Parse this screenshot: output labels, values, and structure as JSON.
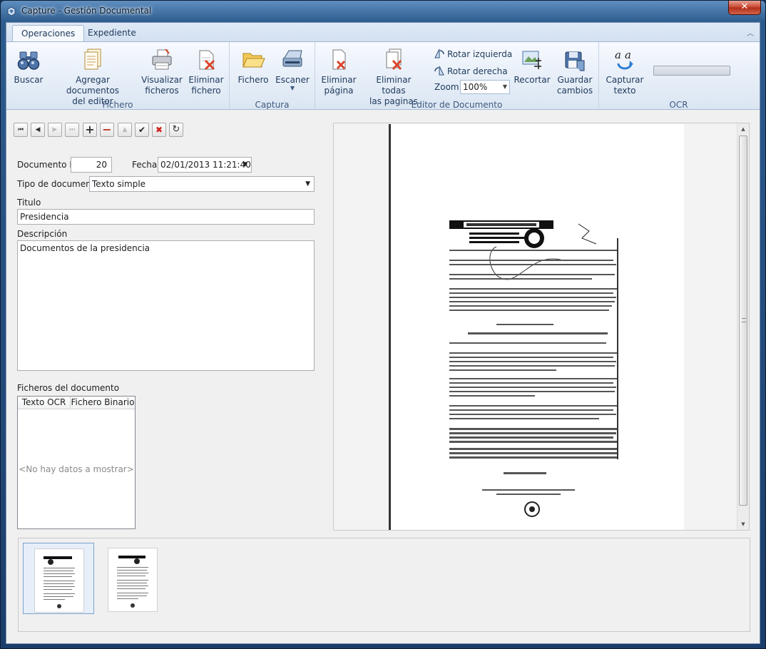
{
  "window": {
    "title": "Capture - Gestión Documental",
    "close_label": "✕"
  },
  "ribbon": {
    "tabs": [
      {
        "label": "Operaciones",
        "active": true
      },
      {
        "label": "Expediente",
        "active": false
      }
    ],
    "groups": {
      "fichero": {
        "label": "Fichero",
        "buscar": "Buscar",
        "agregar_1": "Agregar documentos",
        "agregar_2": "del editor",
        "visualizar_1": "Visualizar",
        "visualizar_2": "ficheros",
        "eliminar_1": "Eliminar",
        "eliminar_2": "fichero"
      },
      "captura": {
        "label": "Captura",
        "fichero": "Fichero",
        "escaner": "Escaner"
      },
      "editor": {
        "label": "Editor de Documento",
        "eliminar_pagina_1": "Eliminar",
        "eliminar_pagina_2": "página",
        "eliminar_todas_1": "Eliminar todas",
        "eliminar_todas_2": "las paginas",
        "rotar_izquierda": "Rotar izquierda",
        "rotar_derecha": "Rotar derecha",
        "zoom_label": "Zoom",
        "zoom_value": "100%",
        "recortar": "Recortar",
        "guardar_1": "Guardar",
        "guardar_2": "cambios"
      },
      "ocr": {
        "label": "OCR",
        "capturar_1": "Capturar",
        "capturar_2": "texto",
        "progress": 0
      }
    }
  },
  "form": {
    "documento_id_label": "Documento Id",
    "documento_id_value": "20",
    "fecha_label": "Fecha",
    "fecha_value": "02/01/2013 11:21:40",
    "tipo_label": "Tipo de documento",
    "tipo_value": "Texto simple",
    "titulo_label": "Titulo",
    "titulo_value": "Presidencia",
    "descripcion_label": "Descripción",
    "descripcion_value": "Documentos de la presidencia",
    "ficheros_label": "Ficheros del documento",
    "grid_columns": [
      "Texto OCR",
      "Fichero Binario"
    ],
    "grid_empty": "<No hay datos a mostrar>"
  },
  "navigator": {
    "first": "⏮",
    "prev": "◀",
    "next": "▶",
    "last": "⏭",
    "add": "+",
    "remove": "−",
    "up": "▲",
    "ok": "✔",
    "cancel": "✖",
    "refresh": "↻"
  },
  "colors": {
    "accent": "#1e395b",
    "cancel_red": "#d0211c"
  }
}
